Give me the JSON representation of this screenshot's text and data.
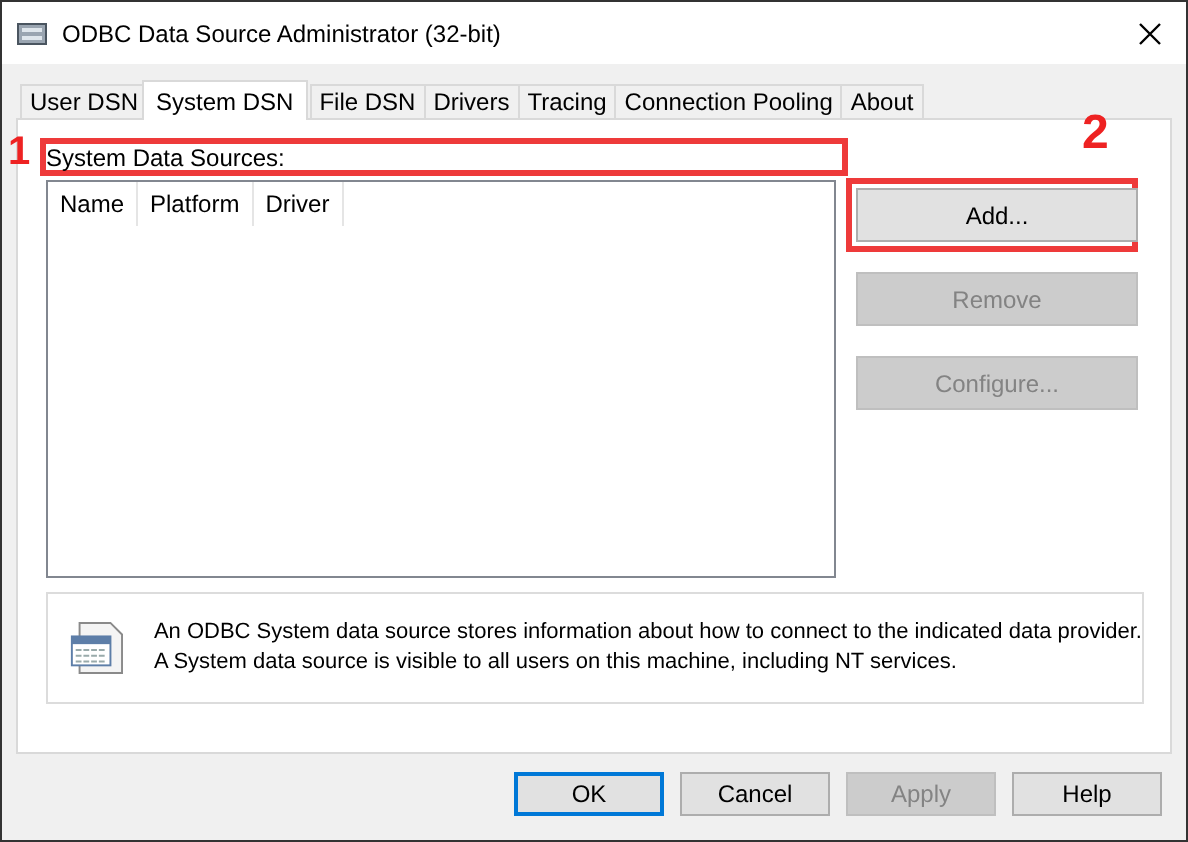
{
  "window": {
    "title": "ODBC Data Source Administrator (32-bit)"
  },
  "tabs": [
    {
      "label": "User DSN",
      "selected": false
    },
    {
      "label": "System DSN",
      "selected": true
    },
    {
      "label": "File DSN",
      "selected": false
    },
    {
      "label": "Drivers",
      "selected": false
    },
    {
      "label": "Tracing",
      "selected": false
    },
    {
      "label": "Connection Pooling",
      "selected": false
    },
    {
      "label": "About",
      "selected": false
    }
  ],
  "sources": {
    "label": "System Data Sources:",
    "columns": [
      "Name",
      "Platform",
      "Driver"
    ]
  },
  "side_buttons": [
    {
      "label": "Add...",
      "disabled": false
    },
    {
      "label": "Remove",
      "disabled": true
    },
    {
      "label": "Configure...",
      "disabled": true
    }
  ],
  "info": [
    "An ODBC System data source stores information about how to connect to the indicated data provider.",
    "A System data source is visible to all users on this machine, including NT services."
  ],
  "annotations": [
    {
      "label": "1"
    },
    {
      "label": "2"
    }
  ],
  "dialog_buttons": [
    {
      "label": "OK",
      "disabled": false,
      "default": true
    },
    {
      "label": "Cancel",
      "disabled": false,
      "default": false
    },
    {
      "label": "Apply",
      "disabled": true,
      "default": false
    },
    {
      "label": "Help",
      "disabled": false,
      "default": false
    }
  ]
}
